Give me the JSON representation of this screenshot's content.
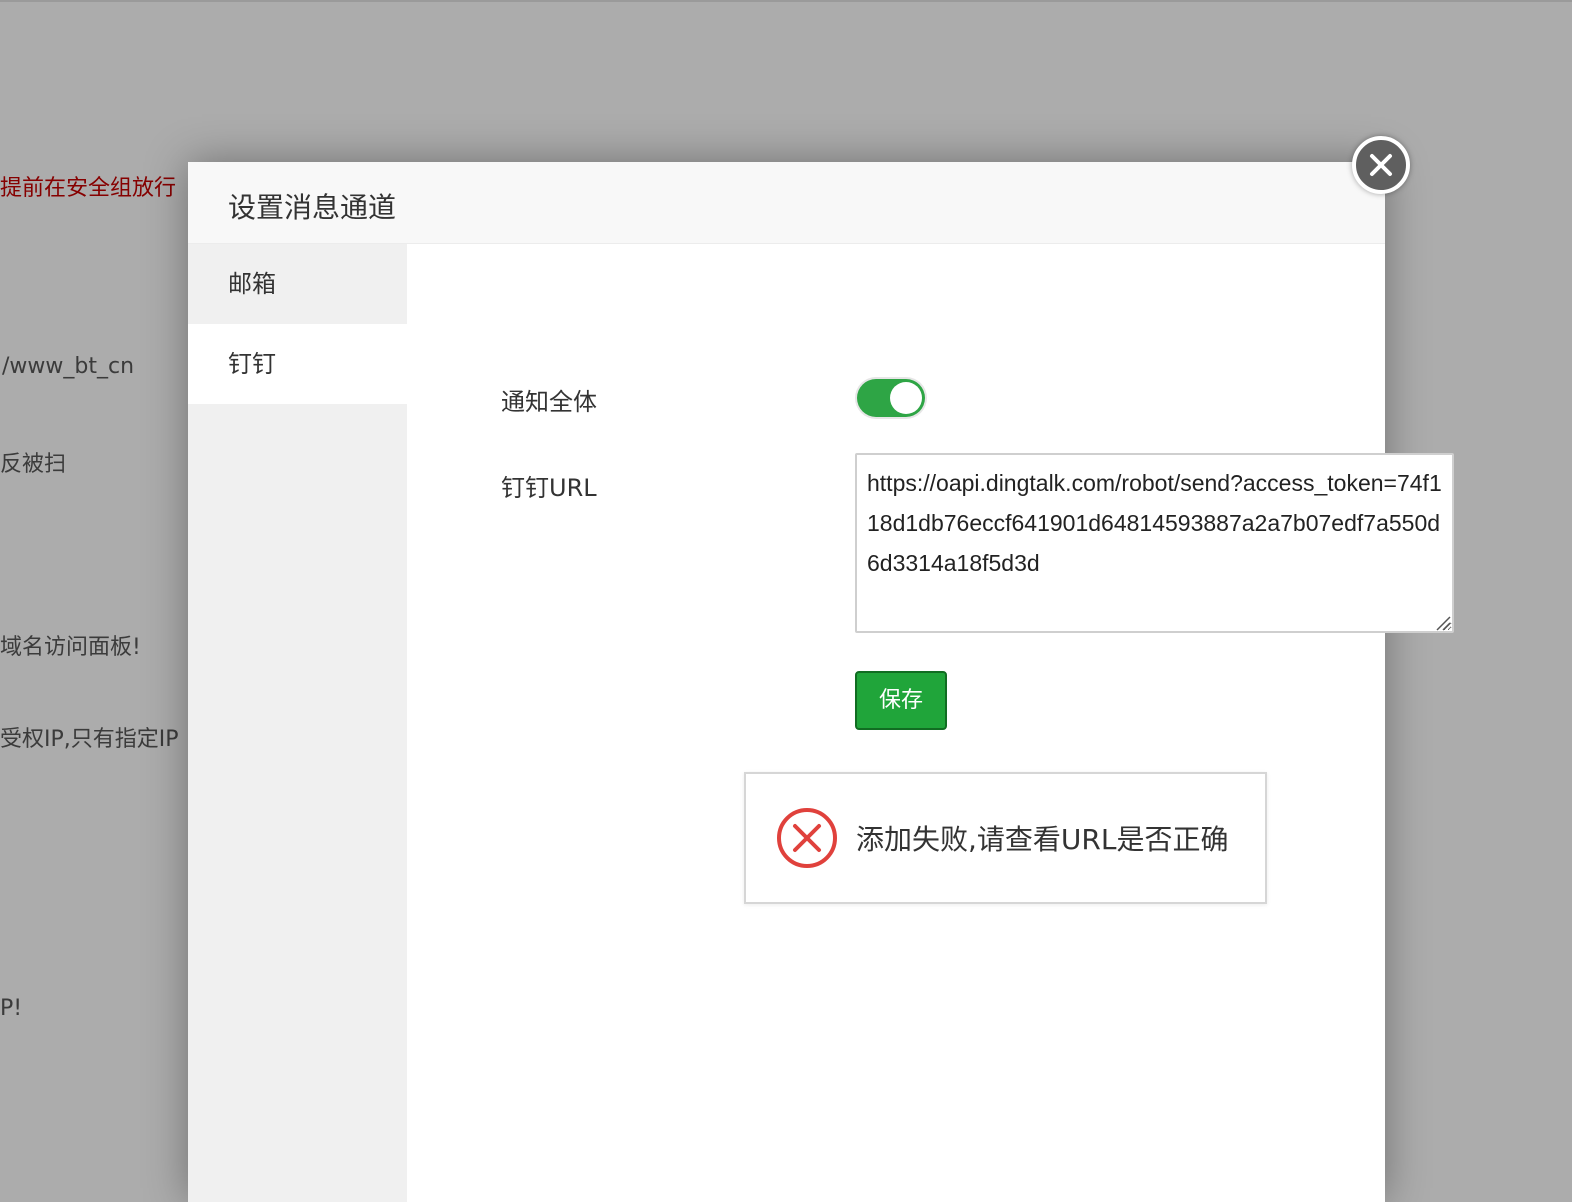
{
  "background": {
    "lines": [
      {
        "text": "提前在安全组放行",
        "color": "#c00000"
      },
      {
        "text": "/www_bt_cn"
      },
      {
        "text": "反被扫"
      },
      {
        "text": "域名访问面板!"
      },
      {
        "text": "受权IP,只有指定IP"
      },
      {
        "text": "P!"
      }
    ]
  },
  "dialog": {
    "title": "设置消息通道",
    "close_icon": "close-icon",
    "tabs": [
      {
        "label": "邮箱",
        "active": false
      },
      {
        "label": "钉钉",
        "active": true
      }
    ],
    "form": {
      "notify_all_label": "通知全体",
      "notify_all_on": true,
      "url_label": "钉钉URL",
      "url_value": "https://oapi.dingtalk.com/robot/send?access_token=74f118d1db76eccf641901d64814593887a2a7b07edf7a550d6d3314a18f5d3d",
      "save_label": "保存"
    },
    "toast": {
      "icon": "error-icon",
      "message": "添加失败,请查看URL是否正确"
    }
  },
  "colors": {
    "accent_green": "#20a53a",
    "error_red": "#e0413c"
  }
}
